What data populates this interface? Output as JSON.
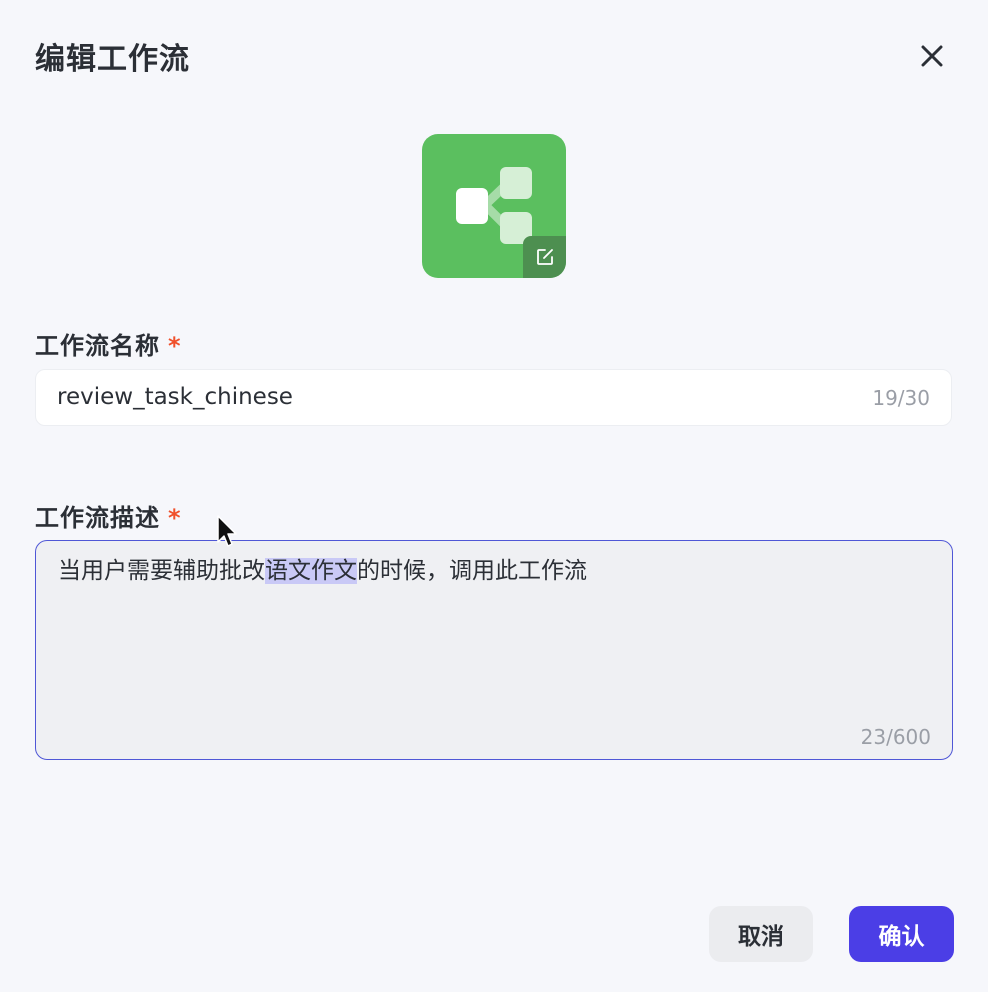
{
  "dialog": {
    "title": "编辑工作流",
    "close_icon": "close-icon"
  },
  "avatar": {
    "icon": "workflow-icon",
    "edit_icon": "edit-icon",
    "background_color": "#5bbf5f"
  },
  "name_field": {
    "label": "工作流名称",
    "required_mark": "*",
    "value": "review_task_chinese",
    "counter": "19/30"
  },
  "description_field": {
    "label": "工作流描述",
    "required_mark": "*",
    "value_before_selection": "当用户需要辅助批改",
    "value_selected": "语文作文",
    "value_after_selection": "的时候，调用此工作流",
    "counter": "23/600"
  },
  "buttons": {
    "cancel": "取消",
    "confirm": "确认"
  },
  "colors": {
    "accent": "#4b3ee6",
    "required": "#f0502b",
    "focus_border": "#4f57d6"
  }
}
